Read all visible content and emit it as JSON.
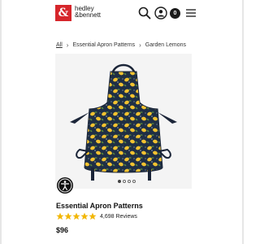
{
  "header": {
    "logo_glyph": "&",
    "brand_line1": "hedley",
    "brand_line2": "&bennett",
    "cart_count": "0",
    "brand_color": "#d6262b",
    "icons": [
      "search-icon",
      "account-icon",
      "cart-icon",
      "menu-icon"
    ]
  },
  "breadcrumb": {
    "items": [
      "All",
      "Essential Apron Patterns",
      "Garden Lemons"
    ],
    "separator": "›"
  },
  "gallery": {
    "image_alt": "apron-garden-lemons",
    "apron_color": "#1f2f45",
    "lemon_color": "#f2c230",
    "leaf_color": "#5b8a3c",
    "slide_count": 4,
    "active_slide": 1
  },
  "product": {
    "title": "Essential Apron Patterns",
    "rating": 5,
    "star_color": "#f2b705",
    "review_count": "4,698 Reviews",
    "price": "$96"
  }
}
